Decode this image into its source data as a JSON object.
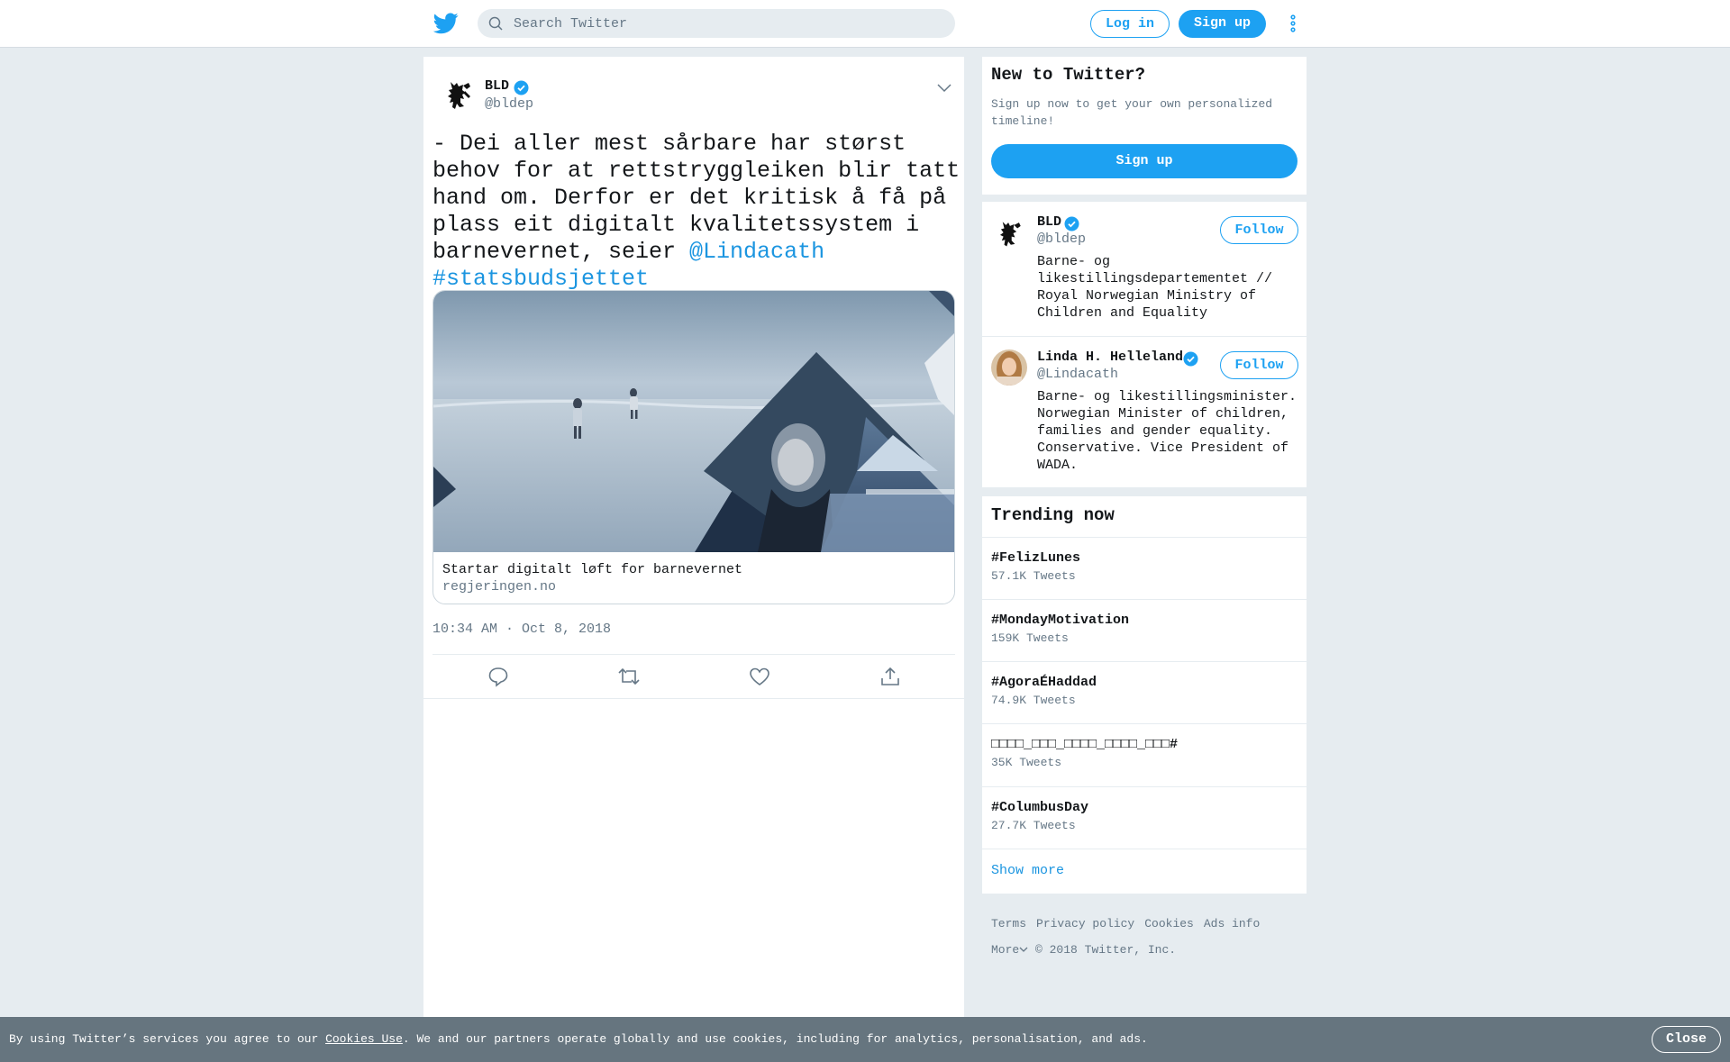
{
  "header": {
    "logo_icon": "twitter-bird-icon",
    "search_placeholder": "Search Twitter",
    "login_label": "Log in",
    "signup_label": "Sign up",
    "more_icon": "vertical-dots-icon"
  },
  "tweet": {
    "author_name": "BLD",
    "author_handle": "@bldep",
    "text_parts": [
      "- Dei aller mest sårbare har størst behov for at rettstryggleiken blir tatt hand om. Derfor er det kritisk å få på plass eit digitalt kvalitetssystem i barnevernet, seier ",
      "@Lindacath",
      " ",
      "#statsbudsjettet"
    ],
    "card_title": "Startar digitalt løft for barnevernet",
    "card_domain": "regjeringen.no",
    "timestamp": "10:34 AM · Oct 8, 2018",
    "actions": [
      "reply-icon",
      "retweet-icon",
      "like-icon",
      "share-icon"
    ]
  },
  "new_to_twitter": {
    "title": "New to Twitter?",
    "subtitle": "Sign up now to get your own personalized timeline!",
    "button": "Sign up"
  },
  "suggested_users": [
    {
      "name": "BLD",
      "handle": "@bldep",
      "bio": "Barne- og likestillingsdepartementet // Royal Norwegian Ministry of Children and Equality",
      "follow_label": "Follow"
    },
    {
      "name": "Linda H. Helleland",
      "handle": "@Lindacath",
      "bio": "Barne- og likestillingsminister. Norwegian Minister of children, families and gender equality. Conservative. Vice President of WADA.",
      "follow_label": "Follow"
    }
  ],
  "trends": {
    "title": "Trending now",
    "items": [
      {
        "name": "#FelizLunes",
        "count": "57.1K Tweets"
      },
      {
        "name": "#MondayMotivation",
        "count": "159K Tweets"
      },
      {
        "name": "#AgoraÉHaddad",
        "count": "74.9K Tweets"
      },
      {
        "name": "□□□□_□□□_□□□□_□□□□_□□□#",
        "count": "35K Tweets"
      },
      {
        "name": "#ColumbusDay",
        "count": "27.7K Tweets"
      }
    ],
    "show_more": "Show more"
  },
  "footer": {
    "links": [
      "Terms",
      "Privacy policy",
      "Cookies",
      "Ads info"
    ],
    "more": "More",
    "copyright": "© 2018 Twitter, Inc."
  },
  "cookie_bar": {
    "prefix": "By using Twitter’s services you agree to our ",
    "link": "Cookies Use",
    "suffix": ". We and our partners operate globally and use cookies, including for analytics, personalisation, and ads.",
    "close": "Close"
  },
  "colors": {
    "brand_blue": "#1da1f2",
    "link_blue": "#1b95e0",
    "background": "#e6ecf0",
    "secondary_text": "#657786",
    "cookie_bar": "#66757f"
  }
}
